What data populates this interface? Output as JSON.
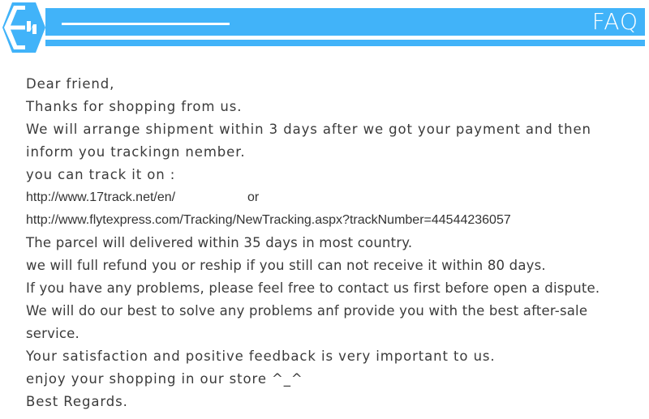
{
  "header": {
    "title": "FAQ",
    "logo_icon": "hexagon-lightning-badge",
    "accent_color": "#41b3f9",
    "title_color": "#ffffff"
  },
  "body": {
    "text_color": "#3b3b3b",
    "background_color": "#ffffff",
    "lines": [
      {
        "id": "greeting",
        "text": "Dear friend,",
        "style": "normal"
      },
      {
        "id": "thanks",
        "text": "Thanks for shopping from us.",
        "style": "normal"
      },
      {
        "id": "shipping-1",
        "text": "We will arrange shipment within 3 days after we got your payment and then",
        "style": "normal"
      },
      {
        "id": "shipping-2",
        "text": "inform you trackingn nember.",
        "style": "normal"
      },
      {
        "id": "track-intro",
        "text": "you can track it on :",
        "style": "normal"
      },
      {
        "id": "tracking-url-1",
        "text": "http://www.17track.net/en/                    or",
        "style": "url"
      },
      {
        "id": "tracking-url-2",
        "text": "http://www.flytexpress.com/Tracking/NewTracking.aspx?trackNumber=44544236057",
        "style": "url"
      },
      {
        "id": "delivery-time",
        "text": "The parcel will delivered within 35 days in most country.",
        "style": "tight"
      },
      {
        "id": "refund-policy",
        "text": "we will full refund you or reship if you still can not receive it within 80 days.",
        "style": "tight"
      },
      {
        "id": "dispute-notice",
        "text": "If you have any problems, please feel free to contact us first before open a dispute.",
        "style": "tight"
      },
      {
        "id": "after-sale-1",
        "text": "We will do our best to solve any problems anf provide you with the best after-sale",
        "style": "tight"
      },
      {
        "id": "after-sale-2",
        "text": "service.",
        "style": "tight"
      },
      {
        "id": "feedback",
        "text": "Your satisfaction and positive feedback is very important to us.",
        "style": "normal"
      },
      {
        "id": "enjoy",
        "text": "enjoy your shopping in our store ^_^",
        "style": "normal"
      },
      {
        "id": "signoff",
        "text": "Best Regards.",
        "style": "normal"
      }
    ]
  },
  "tracking": {
    "carrier_url_1": "http://www.17track.net/en/",
    "separator_word": "or",
    "carrier_url_2": "http://www.flytexpress.com/Tracking/NewTracking.aspx?trackNumber=44544236057",
    "track_number": "44544236057",
    "shipment_days": "3",
    "delivery_days": "35",
    "refund_days": "80"
  }
}
